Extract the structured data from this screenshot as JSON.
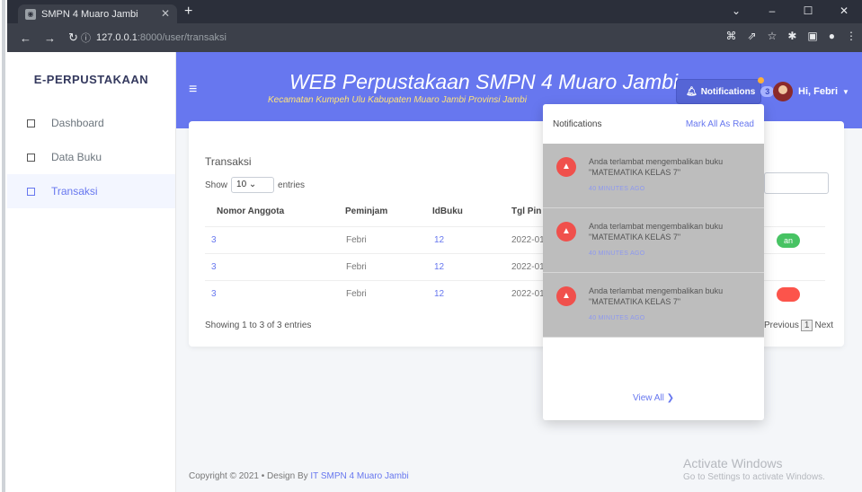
{
  "browser": {
    "tab_title": "SMPN 4 Muaro Jambi",
    "url_host": "127.0.0.1",
    "url_path": ":8000/user/transaksi"
  },
  "sidebar": {
    "brand": "E-PERPUSTAKAAN",
    "items": [
      {
        "label": "Dashboard",
        "active": false
      },
      {
        "label": "Data Buku",
        "active": false
      },
      {
        "label": "Transaksi",
        "active": true
      }
    ]
  },
  "header": {
    "title": "WEB Perpustakaan SMPN 4 Muaro Jambi",
    "subtitle": "Kecamatan Kumpeh Ulu Kabupaten Muaro Jambi Provinsi Jambi",
    "notifications_label": "Notifications",
    "notifications_count": "3",
    "user_greeting": "Hi, Febri"
  },
  "card": {
    "title": "Transaksi",
    "show_label": "Show",
    "entries_value": "10",
    "entries_label": "entries",
    "columns": [
      "Nomor Anggota",
      "Peminjam",
      "IdBuku",
      "Tgl Pin"
    ],
    "rows": [
      {
        "nomor": "3",
        "peminjam": "Febri",
        "idbuku": "12",
        "tgl": "2022-01",
        "status": "an",
        "status_color": "#47c363"
      },
      {
        "nomor": "3",
        "peminjam": "Febri",
        "idbuku": "12",
        "tgl": "2022-01",
        "status": "",
        "status_color": ""
      },
      {
        "nomor": "3",
        "peminjam": "Febri",
        "idbuku": "12",
        "tgl": "2022-01",
        "status": "",
        "status_color": "#fc544b"
      }
    ],
    "showing": "Showing 1 to 3 of 3 entries",
    "pager_prev": "Previous",
    "pager_page": "1",
    "pager_next": "Next"
  },
  "notifications": {
    "header": "Notifications",
    "mark_all": "Mark All As Read",
    "items": [
      {
        "text": "Anda terlambat mengembalikan buku \"MATEMATIKA KELAS 7\"",
        "time": "40 MINUTES AGO"
      },
      {
        "text": "Anda terlambat mengembalikan buku \"MATEMATIKA KELAS 7\"",
        "time": "40 MINUTES AGO"
      },
      {
        "text": "Anda terlambat mengembalikan buku \"MATEMATIKA KELAS 7\"",
        "time": "40 MINUTES AGO"
      }
    ],
    "view_all": "View All ❯"
  },
  "footer": {
    "copyright": "Copyright © 2021",
    "bullet": "•",
    "design_by": "Design By",
    "design_link": "IT SMPN 4 Muaro Jambi"
  },
  "watermark": {
    "line1": "Activate Windows",
    "line2": "Go to Settings to activate Windows."
  },
  "colors": {
    "primary": "#6777ef",
    "success": "#47c363",
    "danger": "#fc544b",
    "subtitle_yellow": "#ffe37a"
  }
}
